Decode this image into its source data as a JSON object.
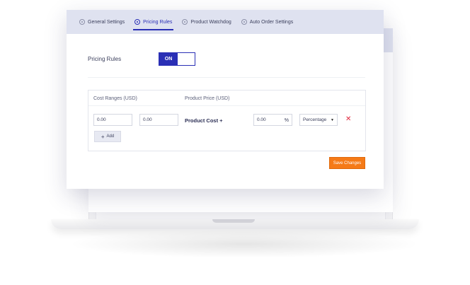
{
  "tabs": [
    {
      "label": "General Settings",
      "icon": "gear-icon"
    },
    {
      "label": "Pricing Rules",
      "icon": "pricing-icon",
      "active": true
    },
    {
      "label": "Product Watchdog",
      "icon": "watchdog-icon"
    },
    {
      "label": "Auto Order Settings",
      "icon": "auto-order-icon"
    }
  ],
  "pricing_rules": {
    "label": "Pricing Rules",
    "toggle_on_label": "ON",
    "toggle_state": "on"
  },
  "table": {
    "col_cost_ranges": "Cost Ranges (USD)",
    "col_product_price": "Product Price (USD)",
    "row": {
      "min": "0.00",
      "max": "0.00",
      "product_cost_label": "Product Cost +",
      "markup": "0.00",
      "markup_unit": "%",
      "type": "Percentage"
    },
    "add_label": "Add"
  },
  "save_label": "Save Changes",
  "colors": {
    "accent": "#2a2fb5",
    "save": "#f57a17",
    "remove": "#e0263d",
    "tabbar": "#dfe2f0"
  }
}
